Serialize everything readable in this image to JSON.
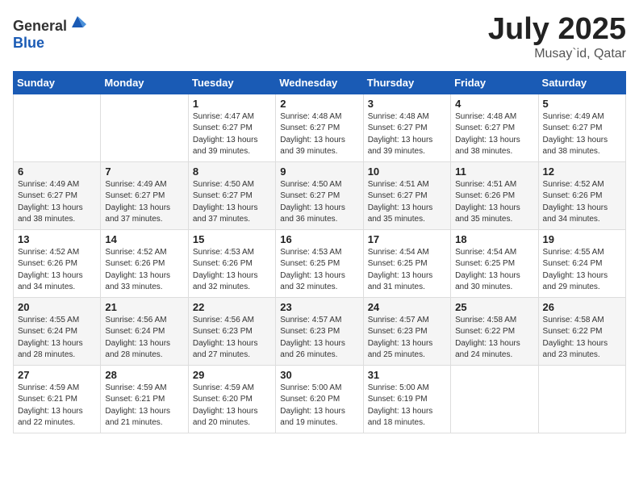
{
  "header": {
    "logo_general": "General",
    "logo_blue": "Blue",
    "title": "July 2025",
    "location": "Musay`id, Qatar"
  },
  "days_of_week": [
    "Sunday",
    "Monday",
    "Tuesday",
    "Wednesday",
    "Thursday",
    "Friday",
    "Saturday"
  ],
  "weeks": [
    [
      {
        "day": "",
        "info": ""
      },
      {
        "day": "",
        "info": ""
      },
      {
        "day": "1",
        "info": "Sunrise: 4:47 AM\nSunset: 6:27 PM\nDaylight: 13 hours and 39 minutes."
      },
      {
        "day": "2",
        "info": "Sunrise: 4:48 AM\nSunset: 6:27 PM\nDaylight: 13 hours and 39 minutes."
      },
      {
        "day": "3",
        "info": "Sunrise: 4:48 AM\nSunset: 6:27 PM\nDaylight: 13 hours and 39 minutes."
      },
      {
        "day": "4",
        "info": "Sunrise: 4:48 AM\nSunset: 6:27 PM\nDaylight: 13 hours and 38 minutes."
      },
      {
        "day": "5",
        "info": "Sunrise: 4:49 AM\nSunset: 6:27 PM\nDaylight: 13 hours and 38 minutes."
      }
    ],
    [
      {
        "day": "6",
        "info": "Sunrise: 4:49 AM\nSunset: 6:27 PM\nDaylight: 13 hours and 38 minutes."
      },
      {
        "day": "7",
        "info": "Sunrise: 4:49 AM\nSunset: 6:27 PM\nDaylight: 13 hours and 37 minutes."
      },
      {
        "day": "8",
        "info": "Sunrise: 4:50 AM\nSunset: 6:27 PM\nDaylight: 13 hours and 37 minutes."
      },
      {
        "day": "9",
        "info": "Sunrise: 4:50 AM\nSunset: 6:27 PM\nDaylight: 13 hours and 36 minutes."
      },
      {
        "day": "10",
        "info": "Sunrise: 4:51 AM\nSunset: 6:27 PM\nDaylight: 13 hours and 35 minutes."
      },
      {
        "day": "11",
        "info": "Sunrise: 4:51 AM\nSunset: 6:26 PM\nDaylight: 13 hours and 35 minutes."
      },
      {
        "day": "12",
        "info": "Sunrise: 4:52 AM\nSunset: 6:26 PM\nDaylight: 13 hours and 34 minutes."
      }
    ],
    [
      {
        "day": "13",
        "info": "Sunrise: 4:52 AM\nSunset: 6:26 PM\nDaylight: 13 hours and 34 minutes."
      },
      {
        "day": "14",
        "info": "Sunrise: 4:52 AM\nSunset: 6:26 PM\nDaylight: 13 hours and 33 minutes."
      },
      {
        "day": "15",
        "info": "Sunrise: 4:53 AM\nSunset: 6:26 PM\nDaylight: 13 hours and 32 minutes."
      },
      {
        "day": "16",
        "info": "Sunrise: 4:53 AM\nSunset: 6:25 PM\nDaylight: 13 hours and 32 minutes."
      },
      {
        "day": "17",
        "info": "Sunrise: 4:54 AM\nSunset: 6:25 PM\nDaylight: 13 hours and 31 minutes."
      },
      {
        "day": "18",
        "info": "Sunrise: 4:54 AM\nSunset: 6:25 PM\nDaylight: 13 hours and 30 minutes."
      },
      {
        "day": "19",
        "info": "Sunrise: 4:55 AM\nSunset: 6:24 PM\nDaylight: 13 hours and 29 minutes."
      }
    ],
    [
      {
        "day": "20",
        "info": "Sunrise: 4:55 AM\nSunset: 6:24 PM\nDaylight: 13 hours and 28 minutes."
      },
      {
        "day": "21",
        "info": "Sunrise: 4:56 AM\nSunset: 6:24 PM\nDaylight: 13 hours and 28 minutes."
      },
      {
        "day": "22",
        "info": "Sunrise: 4:56 AM\nSunset: 6:23 PM\nDaylight: 13 hours and 27 minutes."
      },
      {
        "day": "23",
        "info": "Sunrise: 4:57 AM\nSunset: 6:23 PM\nDaylight: 13 hours and 26 minutes."
      },
      {
        "day": "24",
        "info": "Sunrise: 4:57 AM\nSunset: 6:23 PM\nDaylight: 13 hours and 25 minutes."
      },
      {
        "day": "25",
        "info": "Sunrise: 4:58 AM\nSunset: 6:22 PM\nDaylight: 13 hours and 24 minutes."
      },
      {
        "day": "26",
        "info": "Sunrise: 4:58 AM\nSunset: 6:22 PM\nDaylight: 13 hours and 23 minutes."
      }
    ],
    [
      {
        "day": "27",
        "info": "Sunrise: 4:59 AM\nSunset: 6:21 PM\nDaylight: 13 hours and 22 minutes."
      },
      {
        "day": "28",
        "info": "Sunrise: 4:59 AM\nSunset: 6:21 PM\nDaylight: 13 hours and 21 minutes."
      },
      {
        "day": "29",
        "info": "Sunrise: 4:59 AM\nSunset: 6:20 PM\nDaylight: 13 hours and 20 minutes."
      },
      {
        "day": "30",
        "info": "Sunrise: 5:00 AM\nSunset: 6:20 PM\nDaylight: 13 hours and 19 minutes."
      },
      {
        "day": "31",
        "info": "Sunrise: 5:00 AM\nSunset: 6:19 PM\nDaylight: 13 hours and 18 minutes."
      },
      {
        "day": "",
        "info": ""
      },
      {
        "day": "",
        "info": ""
      }
    ]
  ]
}
